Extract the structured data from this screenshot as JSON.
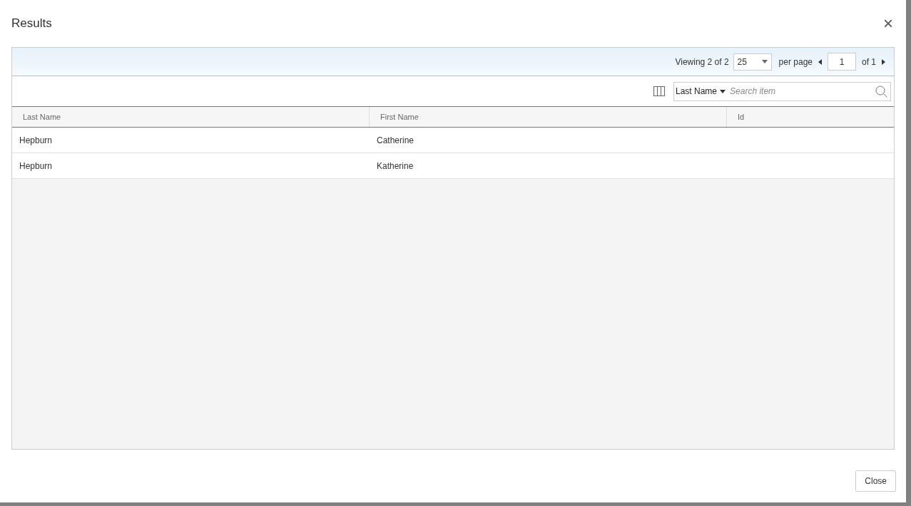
{
  "dialog": {
    "title": "Results",
    "close_icon": "×"
  },
  "pager": {
    "viewing": "Viewing 2 of 2",
    "page_size": "25",
    "per_page": "per page",
    "page": "1",
    "of_pages": "of 1"
  },
  "search": {
    "field": "Last Name",
    "placeholder": "Search item"
  },
  "table": {
    "columns": [
      "Last Name",
      "First Name",
      "Id"
    ],
    "rows": [
      [
        "Hepburn",
        "Catherine",
        ""
      ],
      [
        "Hepburn",
        "Katherine",
        ""
      ]
    ]
  },
  "buttons": [
    "Close"
  ]
}
